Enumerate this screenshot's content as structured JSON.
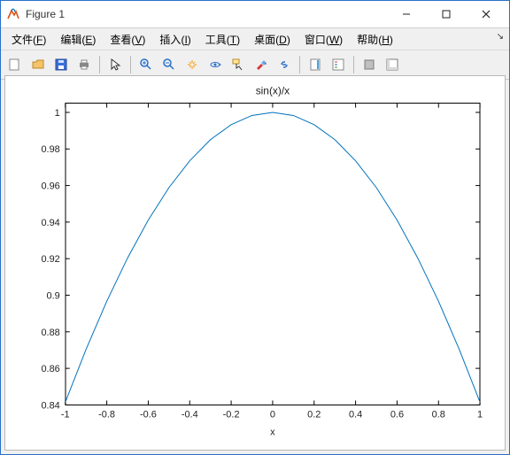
{
  "window": {
    "title": "Figure 1"
  },
  "menus": {
    "file": {
      "label": "文件",
      "accel": "F"
    },
    "edit": {
      "label": "编辑",
      "accel": "E"
    },
    "view": {
      "label": "查看",
      "accel": "V"
    },
    "insert": {
      "label": "插入",
      "accel": "I"
    },
    "tools": {
      "label": "工具",
      "accel": "T"
    },
    "desktop": {
      "label": "桌面",
      "accel": "D"
    },
    "window": {
      "label": "窗口",
      "accel": "W"
    },
    "help": {
      "label": "帮助",
      "accel": "H"
    }
  },
  "chart_data": {
    "type": "line",
    "title": "sin(x)/x",
    "xlabel": "x",
    "ylabel": "",
    "xlim": [
      -1,
      1
    ],
    "ylim": [
      0.84,
      1.005
    ],
    "xticks": [
      -1,
      -0.8,
      -0.6,
      -0.4,
      -0.2,
      0,
      0.2,
      0.4,
      0.6,
      0.8,
      1
    ],
    "xtick_labels": [
      "-1",
      "-0.8",
      "-0.6",
      "-0.4",
      "-0.2",
      "0",
      "0.2",
      "0.4",
      "0.6",
      "0.8",
      "1"
    ],
    "yticks": [
      0.84,
      0.86,
      0.88,
      0.9,
      0.92,
      0.94,
      0.96,
      0.98,
      1
    ],
    "ytick_labels": [
      "0.84",
      "0.86",
      "0.88",
      "0.9",
      "0.92",
      "0.94",
      "0.96",
      "0.98",
      "1"
    ],
    "series": [
      {
        "name": "sin(x)/x",
        "color": "#0072bd",
        "x": [
          -1,
          -0.9,
          -0.8,
          -0.7,
          -0.6,
          -0.5,
          -0.4,
          -0.3,
          -0.2,
          -0.1,
          0,
          0.1,
          0.2,
          0.3,
          0.4,
          0.5,
          0.6,
          0.7,
          0.8,
          0.9,
          1
        ],
        "y": [
          0.8415,
          0.8704,
          0.8967,
          0.9203,
          0.9411,
          0.9589,
          0.9735,
          0.9851,
          0.9933,
          0.9983,
          1.0,
          0.9983,
          0.9933,
          0.9851,
          0.9735,
          0.9589,
          0.9411,
          0.9203,
          0.8967,
          0.8704,
          0.8415
        ]
      }
    ]
  }
}
